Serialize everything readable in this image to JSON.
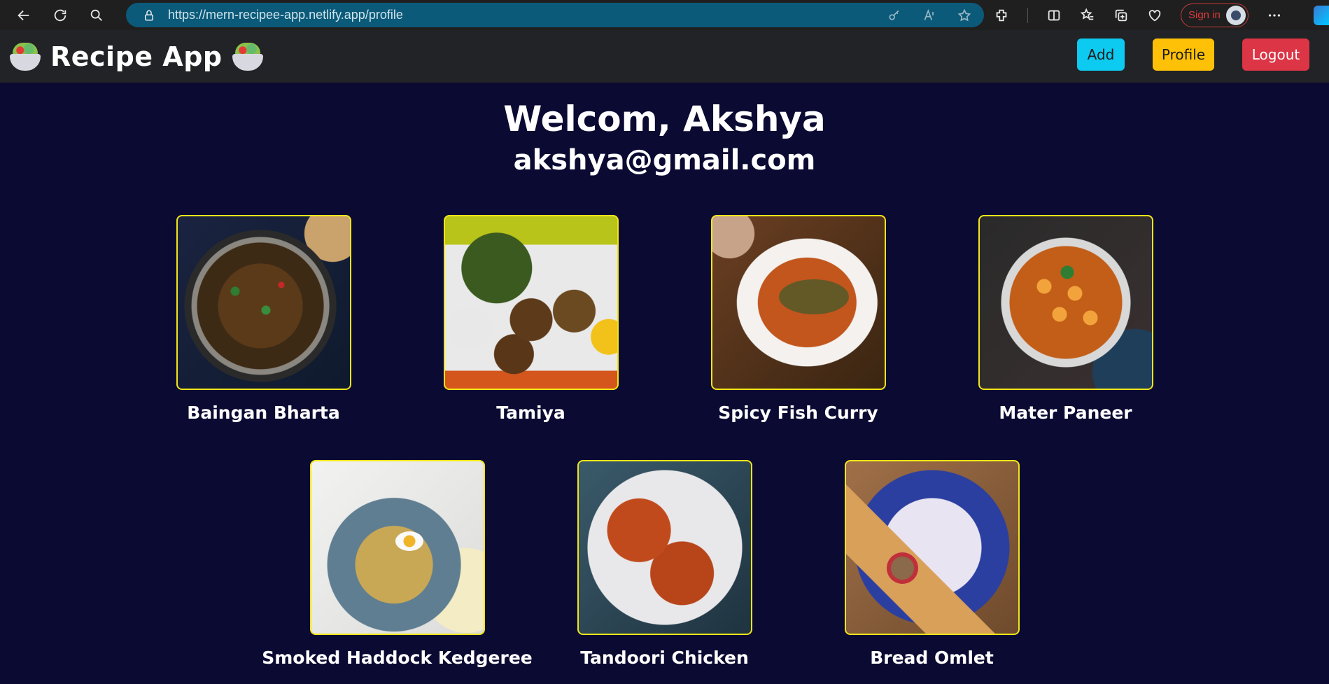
{
  "browser": {
    "url": "https://mern-recipee-app.netlify.app/profile",
    "sign_in_label": "Sign in"
  },
  "navbar": {
    "brand": "Recipe App",
    "buttons": {
      "add": "Add",
      "profile": "Profile",
      "logout": "Logout"
    },
    "colors": {
      "add": "#0dcaf0",
      "profile": "#ffc107",
      "logout": "#dc3545"
    }
  },
  "profile": {
    "welcome": "Welcom, Akshya",
    "email": "akshya@gmail.com"
  },
  "recipes": [
    {
      "title": "Baingan Bharta"
    },
    {
      "title": "Tamiya"
    },
    {
      "title": "Spicy Fish Curry"
    },
    {
      "title": "Mater Paneer"
    },
    {
      "title": "Smoked Haddock Kedgeree"
    },
    {
      "title": "Tandoori Chicken"
    },
    {
      "title": "Bread Omlet"
    }
  ],
  "theme": {
    "background": "#0b0a32",
    "card_border": "#f2e51a"
  }
}
